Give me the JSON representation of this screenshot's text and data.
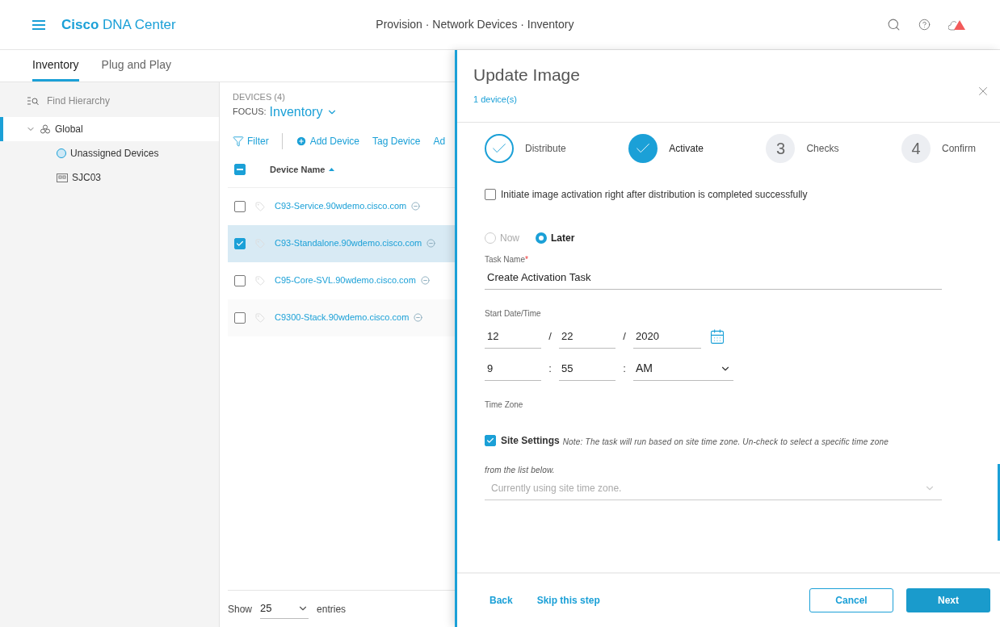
{
  "header": {
    "brand": "Cisco",
    "product": "DNA Center",
    "breadcrumb": "Provision · Network Devices · Inventory"
  },
  "tabs": [
    {
      "label": "Inventory",
      "selected": true
    },
    {
      "label": "Plug and Play",
      "selected": false
    }
  ],
  "hierarchy": {
    "search_placeholder": "Find Hierarchy",
    "tree": [
      {
        "label": "Global",
        "kind": "globe",
        "expanded": true,
        "selected": true,
        "children": [
          {
            "label": "Unassigned Devices",
            "kind": "unassigned",
            "selected": false
          },
          {
            "label": "SJC03",
            "kind": "building",
            "selected": false
          }
        ]
      }
    ]
  },
  "devices": {
    "heading": "DEVICES (4)",
    "focus_label": "FOCUS:",
    "focus_value": "Inventory",
    "toolbar": [
      {
        "label": "Filter",
        "kind": "filter"
      },
      {
        "label": "Add Device",
        "kind": "add"
      },
      {
        "label": "Tag Device",
        "kind": "plain"
      },
      {
        "label": "Ad",
        "kind": "plain"
      }
    ],
    "column": "Device Name",
    "select_all": {
      "indeterminate": true
    },
    "rows": [
      {
        "name": "C93-Service.90wdemo.cisco.com",
        "checked": false,
        "selected": false
      },
      {
        "name": "C93-Standalone.90wdemo.cisco.com",
        "checked": true,
        "selected": true
      },
      {
        "name": "C95-Core-SVL.90wdemo.cisco.com",
        "checked": false,
        "selected": false
      },
      {
        "name": "C9300-Stack.90wdemo.cisco.com",
        "checked": false,
        "selected": false
      }
    ],
    "show_label": "Show",
    "page_size": "25",
    "entries_label": "entries"
  },
  "drawer": {
    "title": "Update Image",
    "subtitle": "1 device(s)",
    "steps": [
      {
        "label": "Distribute",
        "done": true,
        "current": false
      },
      {
        "label": "Activate",
        "done": true,
        "current": true
      },
      {
        "label": "Checks",
        "done": false,
        "current": false,
        "number": "3"
      },
      {
        "label": "Confirm",
        "done": false,
        "current": false,
        "number": "4"
      }
    ],
    "auto_activate": {
      "label": "Initiate image activation right after distribution is completed successfully",
      "checked": false
    },
    "schedule": [
      {
        "label": "Now",
        "selected": false
      },
      {
        "label": "Later",
        "selected": true
      }
    ],
    "task_name": {
      "label": "Task Name",
      "required_mark": "*",
      "value": "Create Activation Task"
    },
    "start": {
      "label": "Start Date/Time",
      "date_fields": [
        "12",
        "22",
        "2020"
      ],
      "date_separators": [
        "/",
        "/"
      ],
      "time_fields": [
        "9",
        "55"
      ],
      "time_separators": [
        ":",
        ":"
      ],
      "meridiem": "AM"
    },
    "time_zone": {
      "label": "Time Zone",
      "site_settings": {
        "label": "Site Settings",
        "checked": true
      },
      "note_lines": [
        "Note: The task will run based on site time zone. Un-check to select a specific time zone",
        "from the list below."
      ],
      "select_placeholder": "Currently using site time zone."
    },
    "footer": {
      "back": "Back",
      "skip": "Skip this step",
      "cancel": "Cancel",
      "next": "Next"
    }
  }
}
